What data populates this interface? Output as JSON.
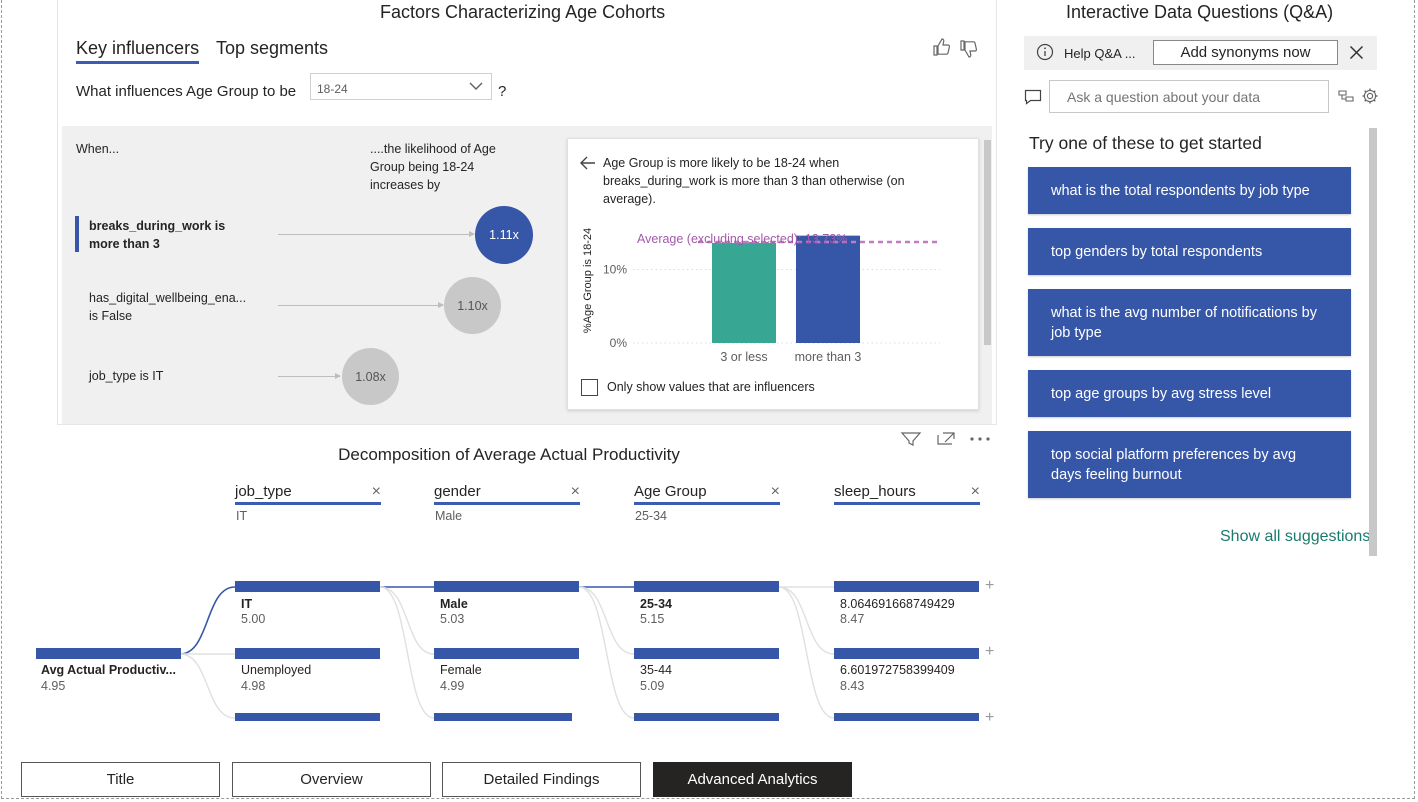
{
  "key_influencers": {
    "title": "Factors Characterizing Age Cohorts",
    "tabs": [
      {
        "label": "Key influencers",
        "active": true
      },
      {
        "label": "Top segments",
        "active": false
      }
    ],
    "question_prefix": "What influences Age Group to be",
    "selected_value": "18-24",
    "question_suffix": "?",
    "when_label": "When...",
    "likelihood_label_1": "....the likelihood of Age",
    "likelihood_label_2": "Group being 18-24",
    "likelihood_label_3": "increases by",
    "factors": [
      {
        "line1": "breaks_during_work is",
        "line2": "more than 3",
        "value": "1.11x",
        "selected": true
      },
      {
        "line1": "has_digital_wellbeing_ena...",
        "line2": "is False",
        "value": "1.10x",
        "selected": false
      },
      {
        "line1": "job_type is IT",
        "line2": "",
        "value": "1.08x",
        "selected": false
      }
    ],
    "detail": {
      "text_1": "Age Group is more likely to be 18-24 when",
      "text_2": "breaks_during_work is more than 3 than otherwise (on",
      "text_3": "average).",
      "checkbox_label": "Only show values that are influencers"
    }
  },
  "chart_data": {
    "type": "bar",
    "categories": [
      "3 or less",
      "more than 3"
    ],
    "values": [
      13.6,
      14.6
    ],
    "ylabel": "%Age Group is 18-24",
    "ytick_labels": [
      "0%",
      "10%"
    ],
    "ylim": [
      0,
      17
    ],
    "reference_line": {
      "label": "Average (excluding selected): 13.73%",
      "value": 13.73,
      "color": "#c07bc6"
    },
    "colors": [
      "#37a794",
      "#3656a8"
    ],
    "grid": true
  },
  "decomposition": {
    "title": "Decomposition of Average Actual Productivity",
    "root": {
      "label": "Avg Actual Productiv...",
      "value": "4.95"
    },
    "columns": [
      {
        "header": "job_type",
        "selected": "IT",
        "nodes": [
          {
            "label": "IT",
            "value": "5.00",
            "bold": true
          },
          {
            "label": "Unemployed",
            "value": "4.98",
            "bold": false
          }
        ]
      },
      {
        "header": "gender",
        "selected": "Male",
        "nodes": [
          {
            "label": "Male",
            "value": "5.03",
            "bold": true
          },
          {
            "label": "Female",
            "value": "4.99",
            "bold": false
          }
        ]
      },
      {
        "header": "Age Group",
        "selected": "25-34",
        "nodes": [
          {
            "label": "25-34",
            "value": "5.15",
            "bold": true
          },
          {
            "label": "35-44",
            "value": "5.09",
            "bold": false
          }
        ]
      },
      {
        "header": "sleep_hours",
        "selected": "",
        "nodes": [
          {
            "label": "8.064691668749429",
            "value": "8.47",
            "bold": false
          },
          {
            "label": "6.601972758399409",
            "value": "8.43",
            "bold": false
          }
        ]
      }
    ]
  },
  "qa": {
    "title": "Interactive Data Questions (Q&A)",
    "help_label": "Help Q&A ...",
    "synonyms_button": "Add synonyms now",
    "placeholder": "Ask a question about your data",
    "try_label": "Try one of these to get started",
    "suggestions": [
      "what is the total respondents by job type",
      "top genders by total respondents",
      "what is the avg number of notifications by job type",
      "top age groups by avg stress level",
      "top social platform preferences by avg days feeling burnout"
    ],
    "show_all": "Show all suggestions"
  },
  "page_tabs": [
    {
      "label": "Title",
      "active": false
    },
    {
      "label": "Overview",
      "active": false
    },
    {
      "label": "Detailed Findings",
      "active": false
    },
    {
      "label": "Advanced Analytics",
      "active": true
    }
  ],
  "colors": {
    "accent": "#3656a8",
    "teal": "#37a794",
    "reference": "#c07bc6",
    "link": "#1a7a6e"
  }
}
